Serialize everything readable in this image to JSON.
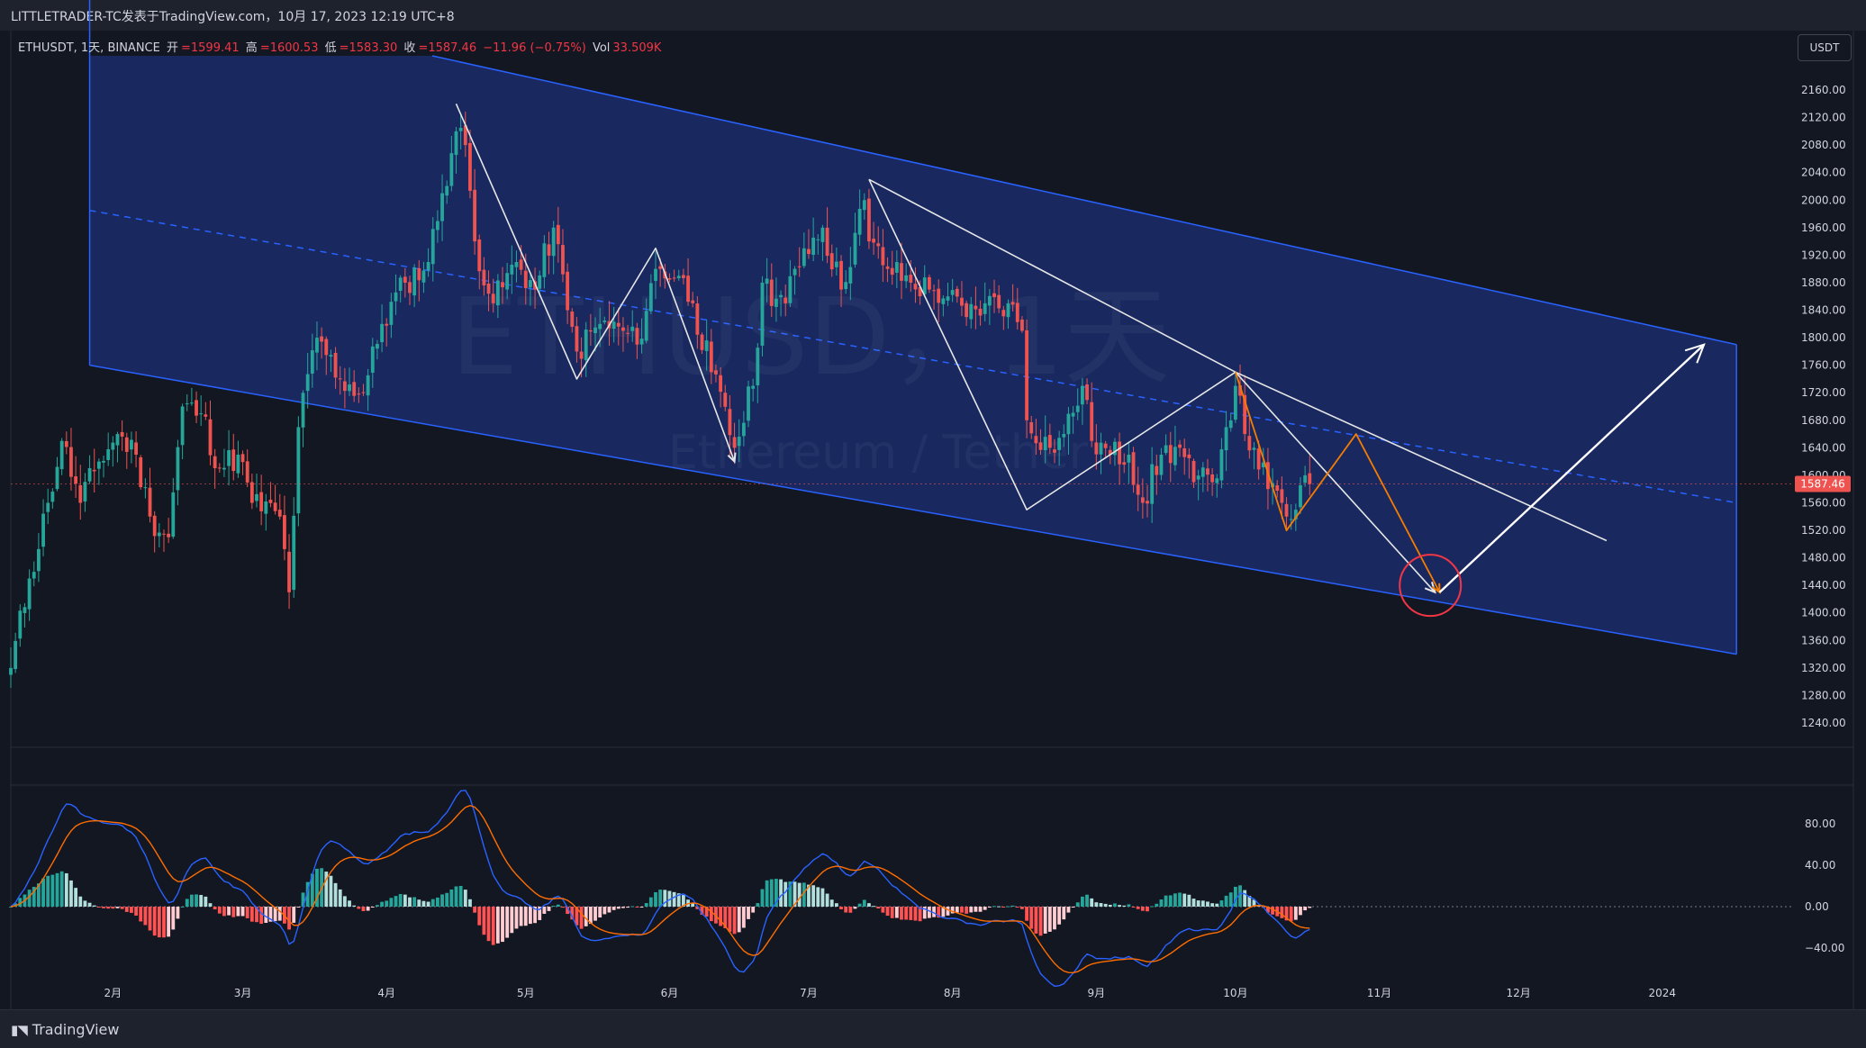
{
  "header": {
    "title": "LITTLETRADER-TC发表于TradingView.com，10月 17, 2023 12:19 UTC+8"
  },
  "legend": {
    "symbol": "ETHUSDT, 1天, BINANCE",
    "open_label": "开",
    "open": "=1599.41",
    "high_label": "高",
    "high": "=1600.53",
    "low_label": "低",
    "low": "=1583.30",
    "close_label": "收",
    "close": "=1587.46",
    "change": "−11.96 (−0.75%)",
    "vol_label": "Vol",
    "vol": "33.509K"
  },
  "currency_button": "USDT",
  "watermark": {
    "line1": "ETHUSD，1天",
    "line2": "Ethereum / Tether"
  },
  "price_tag": "1587.46",
  "footer": {
    "brand": "TradingView"
  },
  "colors": {
    "background": "#131722",
    "up": "#26a69a",
    "down": "#ef5350",
    "channel_fill": "#1b2d6b",
    "channel_line": "#2962ff",
    "drawing_white": "#e6e6e6",
    "drawing_orange": "#f57c00",
    "target_circle": "#f23645",
    "macd_line": "#2962ff",
    "signal_line": "#ff6d00"
  },
  "chart_data": [
    {
      "type": "candlestick",
      "title": "ETHUSDT, 1天, BINANCE",
      "xlabel": "",
      "ylabel": "",
      "ylim": [
        1200,
        2200
      ],
      "y_ticks": [
        1240,
        1280,
        1320,
        1360,
        1400,
        1440,
        1480,
        1520,
        1560,
        1600,
        1640,
        1680,
        1720,
        1760,
        1800,
        1840,
        1880,
        1920,
        1960,
        2000,
        2040,
        2080,
        2120,
        2160
      ],
      "x_tick_labels": [
        "2月",
        "3月",
        "4月",
        "5月",
        "6月",
        "7月",
        "8月",
        "9月",
        "10月",
        "11月",
        "12月",
        "2024"
      ],
      "x_tick_dates": [
        "2023-02-01",
        "2023-03-01",
        "2023-04-01",
        "2023-05-01",
        "2023-06-01",
        "2023-07-01",
        "2023-08-01",
        "2023-09-01",
        "2023-10-01",
        "2023-11-01",
        "2023-12-01",
        "2024-01-01"
      ],
      "x_range": [
        "2023-01-10",
        "2024-01-29"
      ],
      "last_price": 1587.46,
      "price_anchors": [
        {
          "date": "2023-01-10",
          "close": 1320
        },
        {
          "date": "2023-01-14",
          "close": 1450
        },
        {
          "date": "2023-01-18",
          "close": 1560
        },
        {
          "date": "2023-01-21",
          "close": 1650
        },
        {
          "date": "2023-01-25",
          "close": 1560
        },
        {
          "date": "2023-01-29",
          "close": 1620
        },
        {
          "date": "2023-02-02",
          "close": 1660
        },
        {
          "date": "2023-02-06",
          "close": 1630
        },
        {
          "date": "2023-02-09",
          "close": 1540
        },
        {
          "date": "2023-02-13",
          "close": 1510
        },
        {
          "date": "2023-02-16",
          "close": 1700
        },
        {
          "date": "2023-02-20",
          "close": 1690
        },
        {
          "date": "2023-02-24",
          "close": 1610
        },
        {
          "date": "2023-02-28",
          "close": 1630
        },
        {
          "date": "2023-03-03",
          "close": 1560
        },
        {
          "date": "2023-03-09",
          "close": 1540
        },
        {
          "date": "2023-03-11",
          "close": 1430
        },
        {
          "date": "2023-03-13",
          "close": 1670
        },
        {
          "date": "2023-03-17",
          "close": 1800
        },
        {
          "date": "2023-03-22",
          "close": 1740
        },
        {
          "date": "2023-03-27",
          "close": 1720
        },
        {
          "date": "2023-03-31",
          "close": 1820
        },
        {
          "date": "2023-04-05",
          "close": 1880
        },
        {
          "date": "2023-04-10",
          "close": 1910
        },
        {
          "date": "2023-04-13",
          "close": 2010
        },
        {
          "date": "2023-04-16",
          "close": 2100
        },
        {
          "date": "2023-04-18",
          "close": 2080
        },
        {
          "date": "2023-04-20",
          "close": 1940
        },
        {
          "date": "2023-04-24",
          "close": 1850
        },
        {
          "date": "2023-04-29",
          "close": 1910
        },
        {
          "date": "2023-05-03",
          "close": 1870
        },
        {
          "date": "2023-05-07",
          "close": 1960
        },
        {
          "date": "2023-05-10",
          "close": 1840
        },
        {
          "date": "2023-05-12",
          "close": 1780
        },
        {
          "date": "2023-05-17",
          "close": 1820
        },
        {
          "date": "2023-05-22",
          "close": 1810
        },
        {
          "date": "2023-05-25",
          "close": 1790
        },
        {
          "date": "2023-05-29",
          "close": 1900
        },
        {
          "date": "2023-06-03",
          "close": 1890
        },
        {
          "date": "2023-06-06",
          "close": 1850
        },
        {
          "date": "2023-06-10",
          "close": 1750
        },
        {
          "date": "2023-06-15",
          "close": 1640
        },
        {
          "date": "2023-06-19",
          "close": 1730
        },
        {
          "date": "2023-06-21",
          "close": 1880
        },
        {
          "date": "2023-06-26",
          "close": 1850
        },
        {
          "date": "2023-06-30",
          "close": 1930
        },
        {
          "date": "2023-07-04",
          "close": 1960
        },
        {
          "date": "2023-07-08",
          "close": 1870
        },
        {
          "date": "2023-07-13",
          "close": 2000
        },
        {
          "date": "2023-07-14",
          "close": 1940
        },
        {
          "date": "2023-07-18",
          "close": 1900
        },
        {
          "date": "2023-07-23",
          "close": 1880
        },
        {
          "date": "2023-07-27",
          "close": 1870
        },
        {
          "date": "2023-07-31",
          "close": 1860
        },
        {
          "date": "2023-08-04",
          "close": 1830
        },
        {
          "date": "2023-08-08",
          "close": 1850
        },
        {
          "date": "2023-08-13",
          "close": 1850
        },
        {
          "date": "2023-08-16",
          "close": 1810
        },
        {
          "date": "2023-08-17",
          "close": 1680
        },
        {
          "date": "2023-08-22",
          "close": 1640
        },
        {
          "date": "2023-08-25",
          "close": 1660
        },
        {
          "date": "2023-08-29",
          "close": 1730
        },
        {
          "date": "2023-08-31",
          "close": 1650
        },
        {
          "date": "2023-09-04",
          "close": 1630
        },
        {
          "date": "2023-09-08",
          "close": 1630
        },
        {
          "date": "2023-09-11",
          "close": 1560
        },
        {
          "date": "2023-09-15",
          "close": 1630
        },
        {
          "date": "2023-09-19",
          "close": 1640
        },
        {
          "date": "2023-09-22",
          "close": 1590
        },
        {
          "date": "2023-09-26",
          "close": 1590
        },
        {
          "date": "2023-09-29",
          "close": 1670
        },
        {
          "date": "2023-10-01",
          "close": 1730
        },
        {
          "date": "2023-10-03",
          "close": 1660
        },
        {
          "date": "2023-10-05",
          "close": 1640
        },
        {
          "date": "2023-10-08",
          "close": 1580
        },
        {
          "date": "2023-10-11",
          "close": 1560
        },
        {
          "date": "2023-10-12",
          "close": 1540
        },
        {
          "date": "2023-10-14",
          "close": 1550
        },
        {
          "date": "2023-10-16",
          "close": 1600
        },
        {
          "date": "2023-10-17",
          "close": 1587.46
        }
      ],
      "channel": {
        "upper": [
          {
            "date": "2023-01-27",
            "price": 2320
          },
          {
            "date": "2024-01-17",
            "price": 1790
          }
        ],
        "midline": [
          {
            "date": "2023-01-27",
            "price": 1985
          },
          {
            "date": "2024-01-17",
            "price": 1560
          }
        ],
        "lower": [
          {
            "date": "2023-01-27",
            "price": 1760
          },
          {
            "date": "2024-01-17",
            "price": 1340
          }
        ]
      },
      "drawings": {
        "white_zigzag": [
          {
            "date": "2023-04-16",
            "price": 2140
          },
          {
            "date": "2023-05-12",
            "price": 1740
          },
          {
            "date": "2023-05-29",
            "price": 1930
          },
          {
            "date": "2023-06-15",
            "price": 1620
          }
        ],
        "white_zigzag_2": [
          {
            "date": "2023-07-14",
            "price": 2030
          },
          {
            "date": "2023-08-17",
            "price": 1550
          },
          {
            "date": "2023-10-01",
            "price": 1750
          },
          {
            "date": "2023-11-13",
            "price": 1430
          }
        ],
        "white_trendline": [
          {
            "date": "2023-07-14",
            "price": 2030
          },
          {
            "date": "2023-10-01",
            "price": 1750
          },
          {
            "date": "2023-12-20",
            "price": 1505
          }
        ],
        "white_target_arrow": [
          {
            "date": "2023-11-14",
            "price": 1430
          },
          {
            "date": "2024-01-10",
            "price": 1790
          }
        ],
        "orange_path": [
          {
            "date": "2023-10-01",
            "price": 1750
          },
          {
            "date": "2023-10-12",
            "price": 1520
          },
          {
            "date": "2023-10-27",
            "price": 1660
          },
          {
            "date": "2023-11-14",
            "price": 1430
          }
        ],
        "target_circle": {
          "date": "2023-11-12",
          "price": 1440
        }
      }
    },
    {
      "type": "macd",
      "ylim": [
        -60,
        110
      ],
      "y_ticks": [
        80,
        40,
        0,
        -40
      ],
      "y_tick_labels": [
        "80.00",
        "40.00",
        "0.00",
        "−40.00"
      ],
      "series": [
        {
          "name": "",
          "kind": "macd_line"
        },
        {
          "name": "",
          "kind": "signal_line"
        },
        {
          "name": "",
          "kind": "histogram"
        }
      ]
    }
  ]
}
